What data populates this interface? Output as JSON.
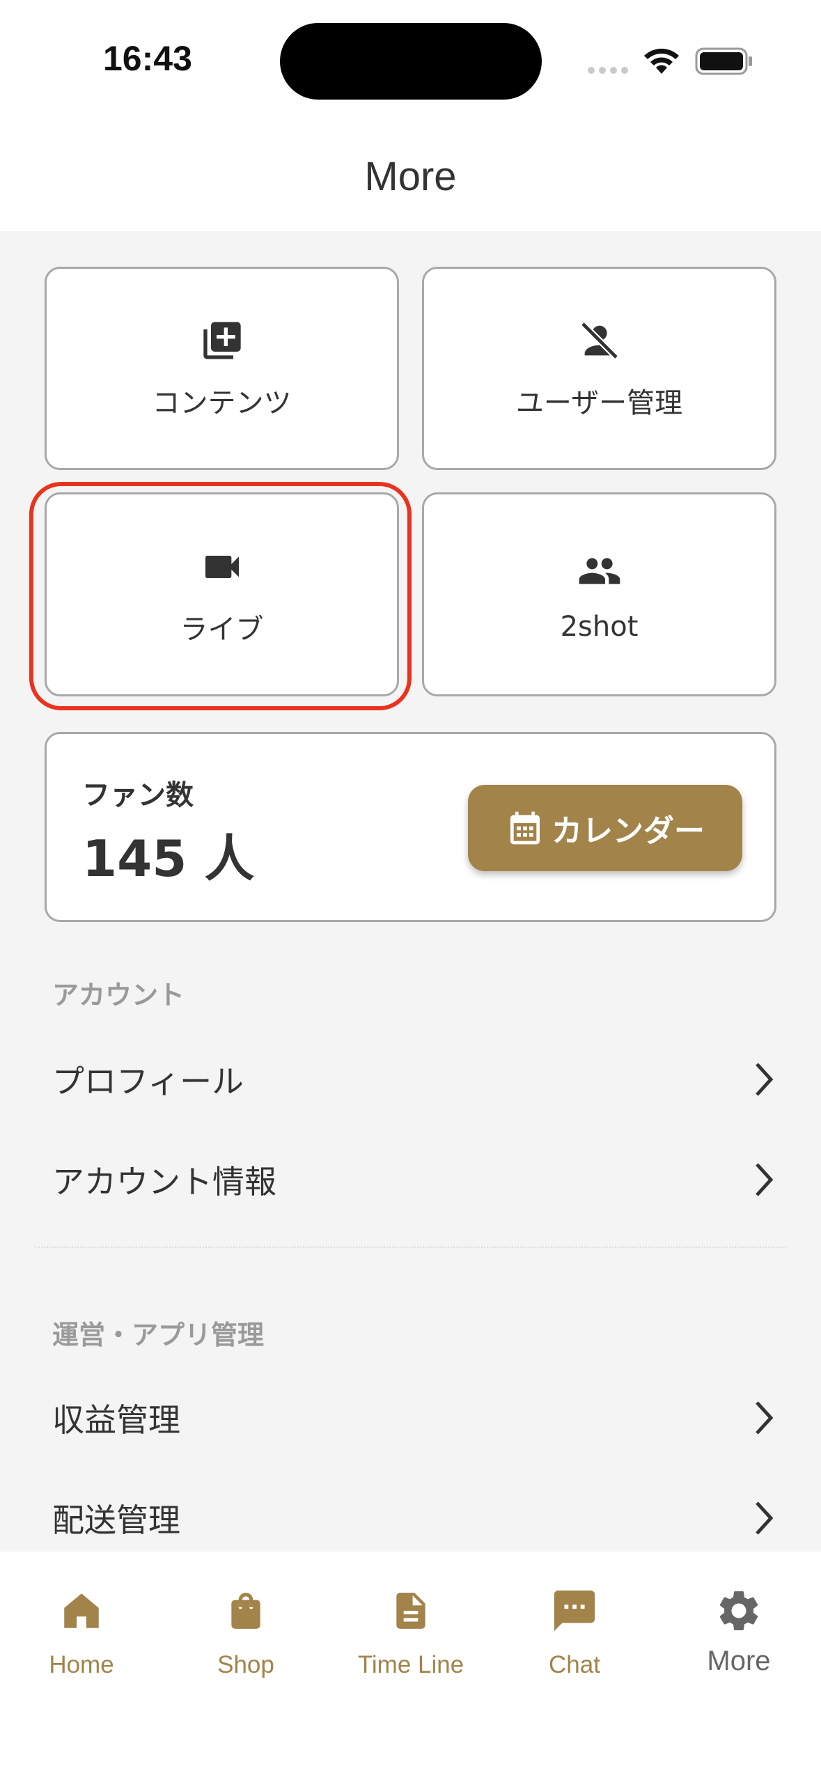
{
  "status_bar": {
    "time": "16:43"
  },
  "header": {
    "title": "More"
  },
  "tiles": [
    {
      "label": "コンテンツ",
      "icon": "add-to-library-icon"
    },
    {
      "label": "ユーザー管理",
      "icon": "person-off-icon"
    },
    {
      "label": "ライブ",
      "icon": "video-camera-icon"
    },
    {
      "label": "2shot",
      "icon": "people-icon"
    }
  ],
  "fans": {
    "label": "ファン数",
    "count": "145 人",
    "calendar_label": "カレンダー"
  },
  "account_section": {
    "title": "アカウント",
    "items": [
      {
        "label": "プロフィール"
      },
      {
        "label": "アカウント情報"
      }
    ]
  },
  "management_section": {
    "title": "運営・アプリ管理",
    "items": [
      {
        "label": "収益管理"
      },
      {
        "label": "配送管理"
      }
    ]
  },
  "tabbar": {
    "tabs": [
      {
        "label": "Home"
      },
      {
        "label": "Shop"
      },
      {
        "label": "Time Line"
      },
      {
        "label": "Chat"
      },
      {
        "label": "More"
      }
    ],
    "active": "More"
  },
  "colors": {
    "accent": "#a2834a",
    "highlight": "#e8341f",
    "background": "#f4f4f4"
  }
}
